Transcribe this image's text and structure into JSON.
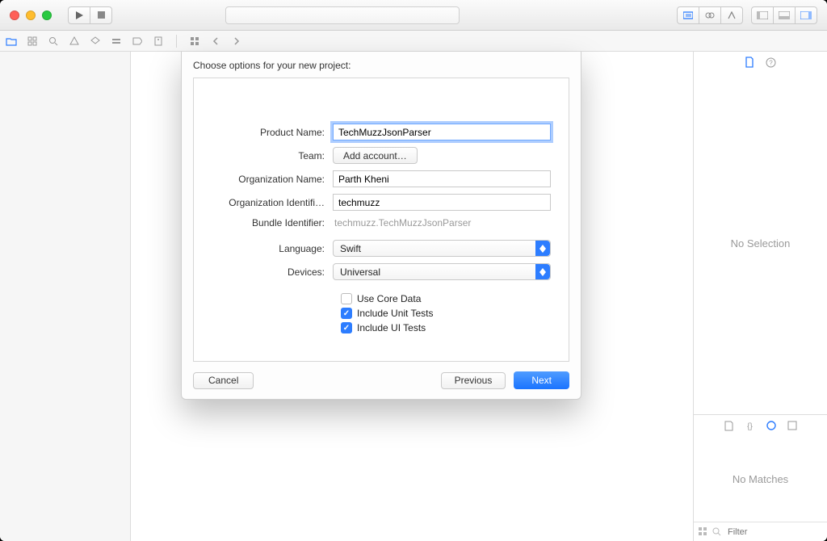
{
  "sheet": {
    "title": "Choose options for your new project:",
    "labels": {
      "product_name": "Product Name:",
      "team": "Team:",
      "org_name": "Organization Name:",
      "org_id": "Organization Identifi…",
      "bundle_id": "Bundle Identifier:",
      "language": "Language:",
      "devices": "Devices:"
    },
    "values": {
      "product_name": "TechMuzzJsonParser",
      "team_button": "Add account…",
      "org_name": "Parth Kheni",
      "org_id": "techmuzz",
      "bundle_id": "techmuzz.TechMuzzJsonParser",
      "language": "Swift",
      "devices": "Universal"
    },
    "checks": {
      "core_data": {
        "label": "Use Core Data",
        "checked": false
      },
      "unit_tests": {
        "label": "Include Unit Tests",
        "checked": true
      },
      "ui_tests": {
        "label": "Include UI Tests",
        "checked": true
      }
    },
    "buttons": {
      "cancel": "Cancel",
      "prev": "Previous",
      "next": "Next"
    }
  },
  "inspector": {
    "no_selection": "No Selection",
    "no_matches": "No Matches",
    "filter_placeholder": "Filter"
  }
}
